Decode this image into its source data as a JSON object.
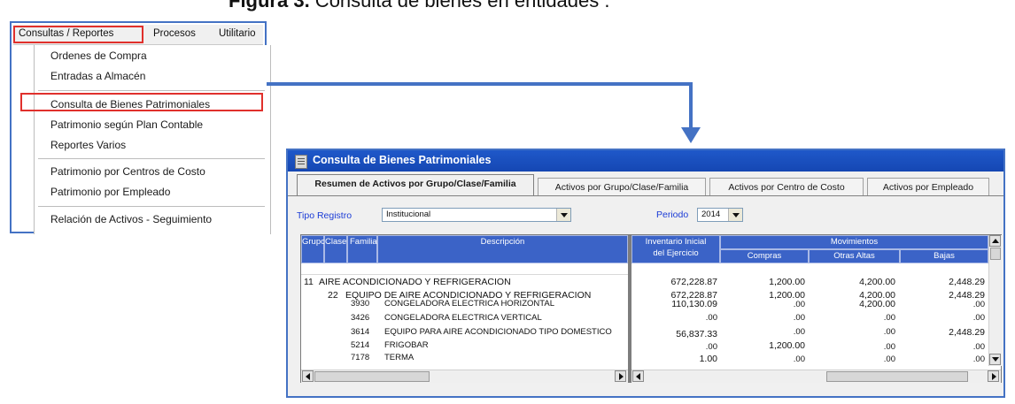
{
  "figure_caption": {
    "bold": "Figura 3.",
    "text": " Consulta de bienes en entidades ."
  },
  "menu": {
    "bar_items": [
      "Consultas / Reportes",
      "Procesos",
      "Utilitario"
    ],
    "items": [
      "Ordenes de Compra",
      "Entradas a Almacén",
      "Consulta de Bienes Patrimoniales",
      "Patrimonio según Plan Contable",
      "Reportes Varios",
      "Patrimonio por Centros de Costo",
      "Patrimonio por Empleado",
      "Relación de Activos - Seguimiento"
    ],
    "highlight_color": "#e0302c"
  },
  "window": {
    "title": "Consulta de Bienes Patrimoniales",
    "tabs": [
      "Resumen de Activos por Grupo/Clase/Familia",
      "Activos por Grupo/Clase/Familia",
      "Activos por Centro de Costo",
      "Activos por Empleado"
    ],
    "tipo_registro_label": "Tipo Registro",
    "tipo_registro_value": "Institucional",
    "periodo_label": "Periodo",
    "periodo_value": "2014"
  },
  "grid": {
    "headers": {
      "grupo": "Grupo",
      "clase": "Clase",
      "familia": "Familia",
      "descripcion": "Descripción",
      "inventario_line1": "Inventario Inicial",
      "inventario_line2": "del Ejercicio",
      "movimientos": "Movimientos",
      "compras": "Compras",
      "otras_altas": "Otras Altas",
      "bajas": "Bajas"
    },
    "rows": [
      {
        "code": "11",
        "desc": "AIRE ACONDICIONADO Y REFRIGERACION",
        "inventario": "672,228.87",
        "compras": "1,200.00",
        "otras": "4,200.00",
        "bajas": "2,448.29"
      },
      {
        "code": "22",
        "desc": "EQUIPO DE AIRE ACONDICIONADO Y REFRIGERACION",
        "inventario": "672,228.87",
        "compras": "1,200.00",
        "otras": "4,200.00",
        "bajas": "2,448.29"
      },
      {
        "code": "3930",
        "desc": "CONGELADORA ELECTRICA HORIZONTAL",
        "inventario": "110,130.09",
        "compras": ".00",
        "otras": "4,200.00",
        "bajas": ".00"
      },
      {
        "code": "3426",
        "desc": "CONGELADORA ELECTRICA VERTICAL",
        "inventario": ".00",
        "compras": ".00",
        "otras": ".00",
        "bajas": ".00"
      },
      {
        "code": "3614",
        "desc": "EQUIPO PARA AIRE ACONDICIONADO TIPO DOMESTICO",
        "inventario": "56,837.33",
        "compras": ".00",
        "otras": ".00",
        "bajas": "2,448.29"
      },
      {
        "code": "5214",
        "desc": "FRIGOBAR",
        "inventario": ".00",
        "compras": "1,200.00",
        "otras": ".00",
        "bajas": ".00"
      },
      {
        "code": "7178",
        "desc": "TERMA",
        "inventario": "1.00",
        "compras": ".00",
        "otras": ".00",
        "bajas": ".00"
      }
    ]
  },
  "colors": {
    "accent": "#4472c4",
    "titlebar": "#1f58c9",
    "grid_header": "#3b63c7",
    "link_blue": "#1a3bd6"
  }
}
